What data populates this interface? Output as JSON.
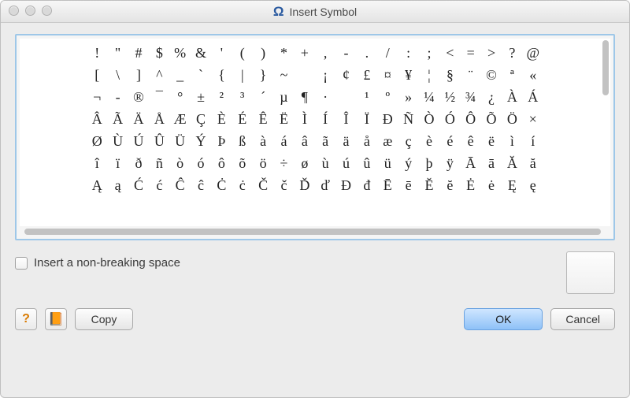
{
  "window": {
    "title": "Insert Symbol",
    "icon": "Ω"
  },
  "checkbox": {
    "label": "Insert a non-breaking space",
    "checked": false
  },
  "buttons": {
    "copy": "Copy",
    "ok": "OK",
    "cancel": "Cancel"
  },
  "icons": {
    "help": "?",
    "book": "📙"
  },
  "symbols": {
    "columns": 28,
    "rows": [
      [
        "!",
        "\"",
        "#",
        "$",
        "%",
        "&",
        "'",
        "(",
        ")",
        "*",
        "+",
        ",",
        "-",
        ".",
        "/",
        ":",
        ";",
        "<",
        "=",
        ">",
        "?",
        "@"
      ],
      [
        "[",
        "\\",
        "]",
        "^",
        "_",
        "`",
        "{",
        "|",
        "}",
        "~",
        "",
        "¡",
        "¢",
        "£",
        "¤",
        "¥",
        "¦",
        "§",
        "¨",
        "©",
        "ª",
        "«"
      ],
      [
        "¬",
        "-",
        "®",
        "¯",
        "°",
        "±",
        "²",
        "³",
        "´",
        "µ",
        "¶",
        "·",
        "",
        "¹",
        "º",
        "»",
        "¼",
        "½",
        "¾",
        "¿",
        "À",
        "Á"
      ],
      [
        "Â",
        "Ã",
        "Ä",
        "Å",
        "Æ",
        "Ç",
        "È",
        "É",
        "Ê",
        "Ë",
        "Ì",
        "Í",
        "Î",
        "Ï",
        "Đ",
        "Ñ",
        "Ò",
        "Ó",
        "Ô",
        "Õ",
        "Ö",
        "×"
      ],
      [
        "Ø",
        "Ù",
        "Ú",
        "Û",
        "Ü",
        "Ý",
        "Þ",
        "ß",
        "à",
        "á",
        "â",
        "ã",
        "ä",
        "å",
        "æ",
        "ç",
        "è",
        "é",
        "ê",
        "ë",
        "ì",
        "í"
      ],
      [
        "î",
        "ï",
        "ð",
        "ñ",
        "ò",
        "ó",
        "ô",
        "õ",
        "ö",
        "÷",
        "ø",
        "ù",
        "ú",
        "û",
        "ü",
        "ý",
        "þ",
        "ÿ",
        "Ā",
        "ā",
        "Ă",
        "ă"
      ],
      [
        "Ą",
        "ą",
        "Ć",
        "ć",
        "Ĉ",
        "ĉ",
        "Ċ",
        "ċ",
        "Č",
        "č",
        "Ď",
        "ď",
        "Đ",
        "đ",
        "Ē",
        "ē",
        "Ĕ",
        "ĕ",
        "Ė",
        "ė",
        "Ę",
        "ę"
      ]
    ]
  }
}
